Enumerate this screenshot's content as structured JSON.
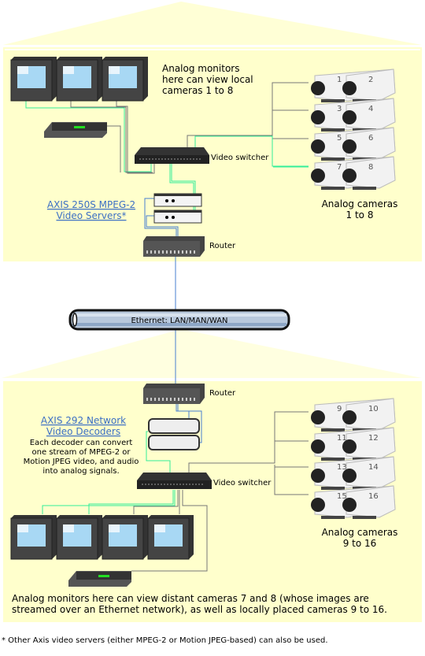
{
  "colors": {
    "building": "#ffffcc",
    "video_cable": "#33ee99",
    "cable": "#777777",
    "network_cable": "#4a7fd0",
    "link": "#3c6fc4"
  },
  "top_site": {
    "monitors_label": [
      "Analog monitors",
      "here can view local",
      "cameras 1 to 8"
    ],
    "video_switcher_label": "Video switcher",
    "video_servers_link": [
      "AXIS 250S MPEG-2",
      "Video Servers*"
    ],
    "router_label": "Router",
    "cameras_label": [
      "Analog cameras",
      "1 to 8"
    ],
    "camera_numbers": [
      "1",
      "2",
      "3",
      "4",
      "5",
      "6",
      "7",
      "8"
    ]
  },
  "network": {
    "label": "Ethernet: LAN/MAN/WAN"
  },
  "bottom_site": {
    "router_label": "Router",
    "decoders_link": [
      "AXIS 292 Network",
      "Video Decoders"
    ],
    "decoders_desc": [
      "Each decoder can convert",
      "one stream of MPEG-2 or",
      "Motion JPEG video, and audio",
      "into analog signals."
    ],
    "video_switcher_label": "Video switcher",
    "cameras_label": [
      "Analog cameras",
      "9 to 16"
    ],
    "camera_numbers": [
      "9",
      "10",
      "11",
      "12",
      "13",
      "14",
      "15",
      "16"
    ],
    "monitors_caption": [
      "Analog monitors here can view distant cameras 7 and 8 (whose images are",
      "streamed over an Ethernet network), as well as locally placed cameras 9 to 16."
    ]
  },
  "footnote": "* Other Axis video servers (either MPEG-2 or Motion JPEG-based) can also be used."
}
